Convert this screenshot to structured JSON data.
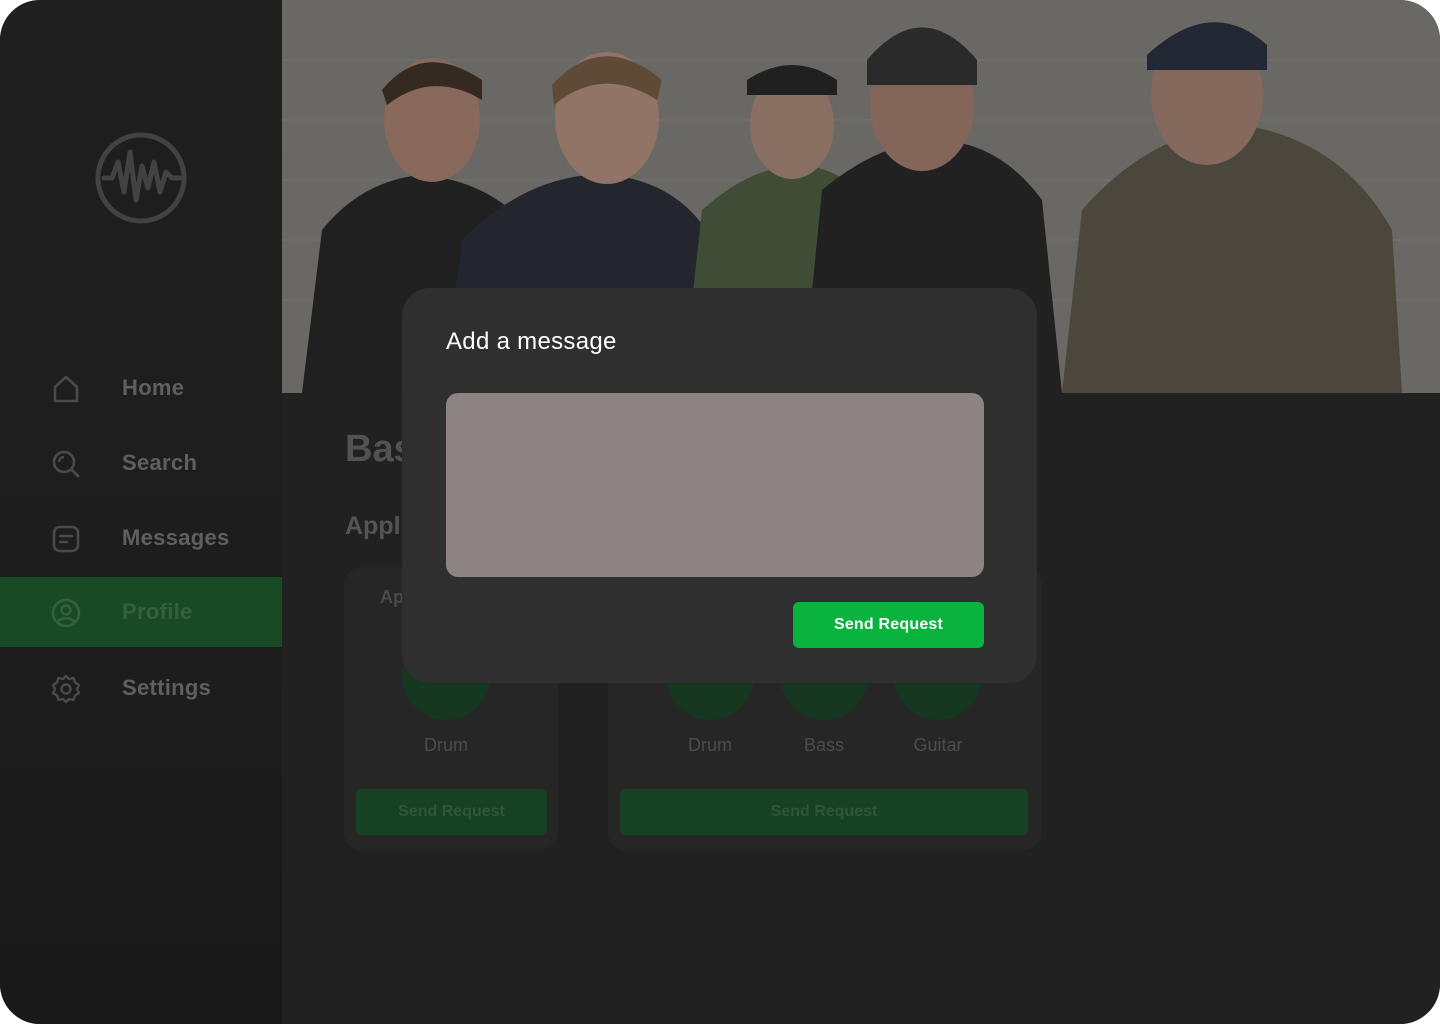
{
  "sidebar": {
    "items": [
      {
        "label": "Home",
        "icon": "home-icon"
      },
      {
        "label": "Search",
        "icon": "search-icon"
      },
      {
        "label": "Messages",
        "icon": "messages-icon"
      },
      {
        "label": "Profile",
        "icon": "profile-icon",
        "active": true
      },
      {
        "label": "Settings",
        "icon": "settings-icon"
      }
    ]
  },
  "main": {
    "hero_image": "band-photo",
    "title_partial": "Bas",
    "section_partial": "Appl",
    "cards": [
      {
        "title_partial": "Ap",
        "instruments": [
          {
            "label": "Drum",
            "icon": "drum-icon"
          }
        ],
        "button_label": "Send Request"
      },
      {
        "instruments": [
          {
            "label": "Drum",
            "icon": "drum-icon"
          },
          {
            "label": "Bass",
            "icon": "bass-icon"
          },
          {
            "label": "Guitar",
            "icon": "guitar-icon"
          }
        ],
        "button_label": "Send Request"
      }
    ]
  },
  "modal": {
    "title": "Add a message",
    "message_value": "",
    "button_label": "Send Request"
  },
  "colors": {
    "accent_green": "#0ab33d",
    "active_nav": "#1f6b33",
    "textarea_bg": "#8c8382"
  }
}
